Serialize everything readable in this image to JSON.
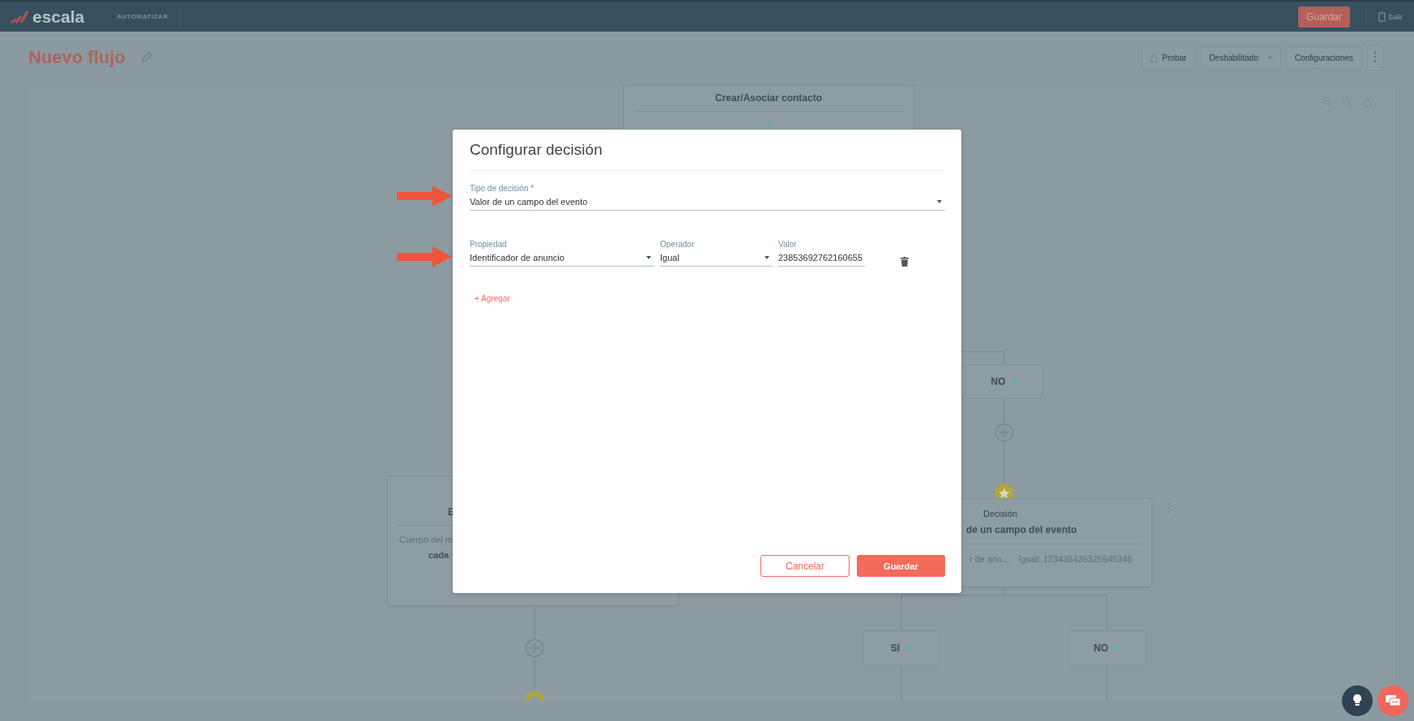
{
  "top_bar": {
    "logo": "escala",
    "section": "AUTOMATIZAR",
    "save_button": "Guardar",
    "exit_button": "Salir"
  },
  "header": {
    "title": "Nuevo flujo",
    "buttons": [
      {
        "kind": "test",
        "label": "Probar"
      },
      {
        "kind": "dropdown",
        "label": "Deshabilitado"
      },
      {
        "kind": "plain",
        "label": "Configuraciones"
      }
    ]
  },
  "canvas": {
    "nodes": [
      {
        "kind": "card",
        "title": "Crear/Asociar contacto"
      },
      {
        "kind": "message",
        "title": "E",
        "body": "Cuerpo del m",
        "detail": "cada"
      },
      {
        "kind": "branch",
        "label": "NO"
      },
      {
        "kind": "decision",
        "type": "Decisión",
        "title": "de un campo del evento",
        "property": "r de anu...",
        "condition": "Igual: 123435435325545345"
      },
      {
        "kind": "branch",
        "label": "SI"
      },
      {
        "kind": "branch",
        "label": "NO"
      }
    ]
  },
  "modal": {
    "title": "Configurar decisión",
    "decision_type": {
      "label": "Tipo de decisión *",
      "value": "Valor de un campo del evento"
    },
    "conditions": [
      {
        "property": {
          "label": "Propiedad",
          "value": "Identificador de anuncio"
        },
        "operator": {
          "label": "Operador",
          "value": "Igual"
        },
        "value": {
          "label": "Valor",
          "value": "23853692762160655"
        }
      }
    ],
    "add_link": "+ Agregar",
    "cancel_button": "Cancelar",
    "save_button": "Guardar"
  }
}
